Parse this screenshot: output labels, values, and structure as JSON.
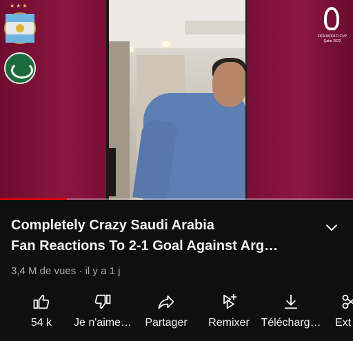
{
  "video": {
    "title_line1": "Completely Crazy Saudi Arabia",
    "title_line2": "Fan Reactions To 2-1 Goal Against Arg…",
    "views": "3,4 M de vues",
    "age": "il y a 1 j",
    "progress_fraction": 0.19
  },
  "overlay": {
    "world_cup_logo_text_line1": "FIFA WORLD CUP",
    "world_cup_logo_text_line2": "Qatar 2022"
  },
  "actions": [
    {
      "icon": "thumbs-up-icon",
      "label": "54 k"
    },
    {
      "icon": "thumbs-down-icon",
      "label": "Je n'aime…"
    },
    {
      "icon": "share-icon",
      "label": "Partager"
    },
    {
      "icon": "remix-icon",
      "label": "Remixer"
    },
    {
      "icon": "download-icon",
      "label": "Télécharg…"
    },
    {
      "icon": "scissors-icon",
      "label": "Ext"
    }
  ],
  "colors": {
    "background": "#0f0f0f",
    "progress": "#ff0000",
    "secondary_text": "#aaaaaa",
    "banner_maroon": "#7a0f36"
  }
}
